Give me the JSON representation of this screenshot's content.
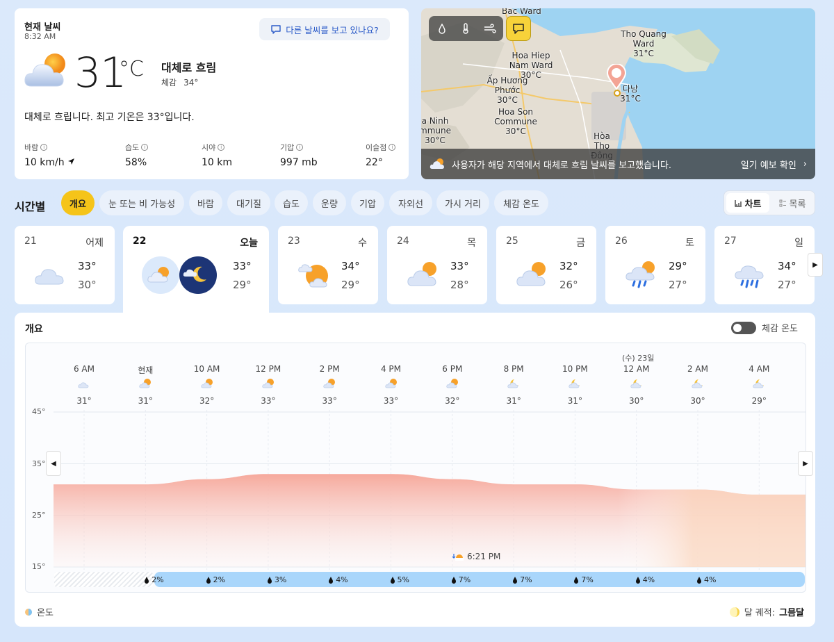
{
  "current": {
    "title": "현재 날씨",
    "time": "8:32 AM",
    "feedback_button": "다른 날씨를 보고 있나요?",
    "temperature": "31",
    "unit": "°C",
    "condition": "대체로 흐림",
    "feels_label": "체감",
    "feels_value": "34°",
    "summary": "대체로 흐립니다. 최고 기온은 33°입니다.",
    "stats": [
      {
        "label": "바람",
        "value": "10 km/h"
      },
      {
        "label": "습도",
        "value": "58%"
      },
      {
        "label": "시야",
        "value": "10 km"
      },
      {
        "label": "기압",
        "value": "997 mb"
      },
      {
        "label": "이슬점",
        "value": "22°"
      }
    ]
  },
  "map": {
    "labels": [
      {
        "text": "Bac Ward"
      },
      {
        "text": "Tho Quang Ward",
        "temp": "31°C"
      },
      {
        "text": "Hoa Hiep Nam Ward",
        "temp": "30°C"
      },
      {
        "text": "Ấp Hương Phước",
        "temp": "30°C"
      },
      {
        "text": "다낭",
        "temp": "31°C"
      },
      {
        "text": "Hoa Son Commune",
        "temp": "30°C"
      },
      {
        "text": "a Ninh mmune",
        "temp": "30°C"
      },
      {
        "text": "Hòa Thọ Đông"
      }
    ],
    "banner_text": "사용자가 해당 지역에서 대체로 흐림 날씨를 보고했습니다.",
    "banner_link": "일기 예보 확인"
  },
  "hourly": {
    "title": "시간별",
    "tabs": [
      "개요",
      "눈 또는 비 가능성",
      "바람",
      "대기질",
      "습도",
      "운량",
      "기압",
      "자외선",
      "가시 거리",
      "체감 온도"
    ],
    "view_chart": "차트",
    "view_list": "목록"
  },
  "days": [
    {
      "num": "21",
      "name": "어제",
      "hi": "33°",
      "lo": "30°",
      "icon": "cloudy-icon"
    },
    {
      "num": "22",
      "name": "오늘",
      "hi": "33°",
      "lo": "29°",
      "icon": "partly-cloudy-day-night-icon"
    },
    {
      "num": "23",
      "name": "수",
      "hi": "34°",
      "lo": "29°",
      "icon": "partly-sunny-icon"
    },
    {
      "num": "24",
      "name": "목",
      "hi": "33°",
      "lo": "28°",
      "icon": "mostly-cloudy-icon"
    },
    {
      "num": "25",
      "name": "금",
      "hi": "32°",
      "lo": "26°",
      "icon": "mostly-cloudy-icon"
    },
    {
      "num": "26",
      "name": "토",
      "hi": "29°",
      "lo": "27°",
      "icon": "rain-showers-icon"
    },
    {
      "num": "27",
      "name": "일",
      "hi": "34°",
      "lo": "27°",
      "icon": "heavy-rain-icon"
    }
  ],
  "overview": {
    "title": "개요",
    "feels_toggle": "체감 온도",
    "date_flag": "(수) 23일",
    "sunset": "6:21 PM",
    "legend_temp": "온도",
    "legend_moon_label": "달 궤적:",
    "legend_moon_value": "그믐달"
  },
  "chart_data": {
    "type": "area",
    "x": [
      "6 AM",
      "현재",
      "10 AM",
      "12 PM",
      "2 PM",
      "4 PM",
      "6 PM",
      "8 PM",
      "10 PM",
      "12 AM",
      "2 AM",
      "4 AM"
    ],
    "temps_label": [
      "31°",
      "31°",
      "32°",
      "33°",
      "33°",
      "33°",
      "32°",
      "31°",
      "31°",
      "30°",
      "30°",
      "29°"
    ],
    "temps": [
      31,
      31,
      32,
      33,
      33,
      33,
      32,
      31,
      31,
      30,
      30,
      29
    ],
    "precip": [
      "2%",
      "2%",
      "3%",
      "4%",
      "5%",
      "7%",
      "7%",
      "7%",
      "4%",
      "4%"
    ],
    "yticks": [
      "45°",
      "35°",
      "25°",
      "15°"
    ],
    "ylim": [
      15,
      45
    ],
    "colors": {
      "fill_top": "#f6a99c",
      "fill_future": "#fbd9c2",
      "precip": "#a9d6fb"
    }
  }
}
